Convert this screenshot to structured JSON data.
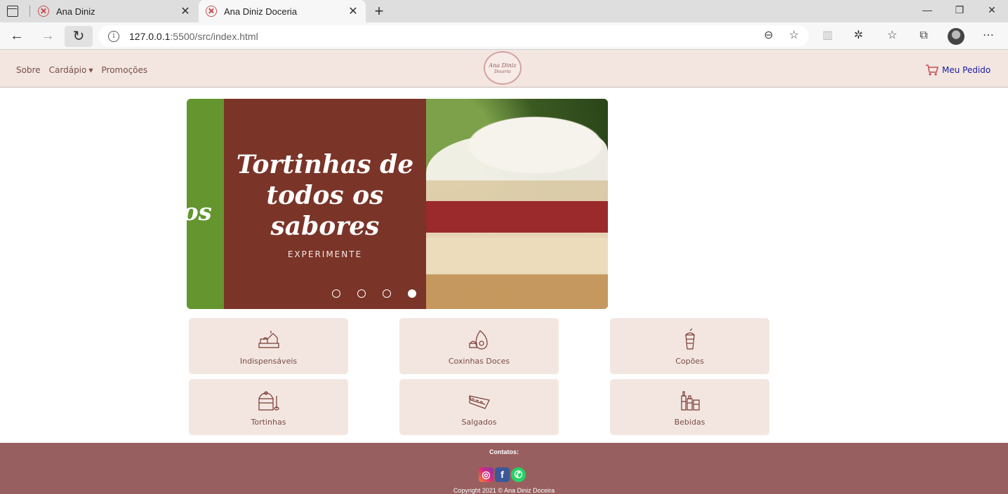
{
  "browser": {
    "tabs": [
      {
        "title": "Ana Diniz",
        "active": false
      },
      {
        "title": "Ana Diniz Doceria",
        "active": true
      }
    ],
    "url_host": "127.0.0.1",
    "url_rest": ":5500/src/index.html",
    "icons": [
      "sidebar-icon",
      "back-icon",
      "forward-icon",
      "reload-icon",
      "info-icon",
      "zoom-icon",
      "favorite-add-icon",
      "trash-icon",
      "extensions-icon",
      "favorites-icon",
      "collections-icon",
      "profile-avatar",
      "more-icon",
      "minimize-icon",
      "restore-icon",
      "close-icon"
    ]
  },
  "header": {
    "nav": {
      "about": "Sobre",
      "menu": "Cardápio",
      "promos": "Promoções"
    },
    "logo": {
      "line1": "Ana Diniz",
      "line2": "Doceria"
    },
    "cart_label": "Meu Pedido"
  },
  "carousel": {
    "prev_slide_fragment": "os",
    "title_lines": [
      "Tortinhas de",
      "todos os",
      "sabores"
    ],
    "cta": "EXPERIMENTE",
    "slide_count": 4,
    "active_slide": 4
  },
  "categories": [
    {
      "label": "Indispensáveis",
      "icon": "cake-slices-icon"
    },
    {
      "label": "Coxinhas Doces",
      "icon": "sweet-coxinha-icon"
    },
    {
      "label": "Copões",
      "icon": "cup-dessert-icon"
    },
    {
      "label": "Tortinhas",
      "icon": "tart-icon"
    },
    {
      "label": "Salgados",
      "icon": "pie-slice-icon"
    },
    {
      "label": "Bebidas",
      "icon": "bottles-icon"
    }
  ],
  "footer": {
    "title": "Contatos:",
    "social": [
      "instagram-icon",
      "facebook-icon",
      "whatsapp-icon"
    ],
    "copyright": "Copyright 2021 © Ana Diniz Doceira"
  },
  "colors": {
    "header_bg": "#f3e6e1",
    "nav_text": "#7a4c46",
    "slide_panel": "#7a3428",
    "slide_green": "#64952f",
    "footer_bg": "#985f60"
  }
}
